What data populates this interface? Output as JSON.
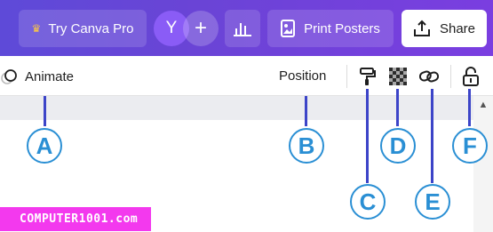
{
  "topbar": {
    "try_pro_label": "Try Canva Pro",
    "avatar_initial": "Y",
    "add_symbol": "+",
    "print_label": "Print Posters",
    "share_label": "Share",
    "icons": {
      "crown": "crown-icon",
      "analytics": "bar-chart-icon",
      "print": "poster-icon",
      "share": "upload-icon"
    }
  },
  "toolbar": {
    "animate_label": "Animate",
    "position_label": "Position",
    "icons": [
      "paint-roller-icon",
      "transparency-icon",
      "link-icon",
      "lock-icon"
    ]
  },
  "callouts": [
    "A",
    "B",
    "C",
    "D",
    "E",
    "F"
  ],
  "watermark": "COMPUTER1001.com",
  "colors": {
    "topbar_start": "#5e4ad8",
    "topbar_end": "#7a3ee0",
    "callout": "#2a8fd4",
    "pointer": "#3c44c8",
    "watermark_bg": "#f339ee"
  }
}
